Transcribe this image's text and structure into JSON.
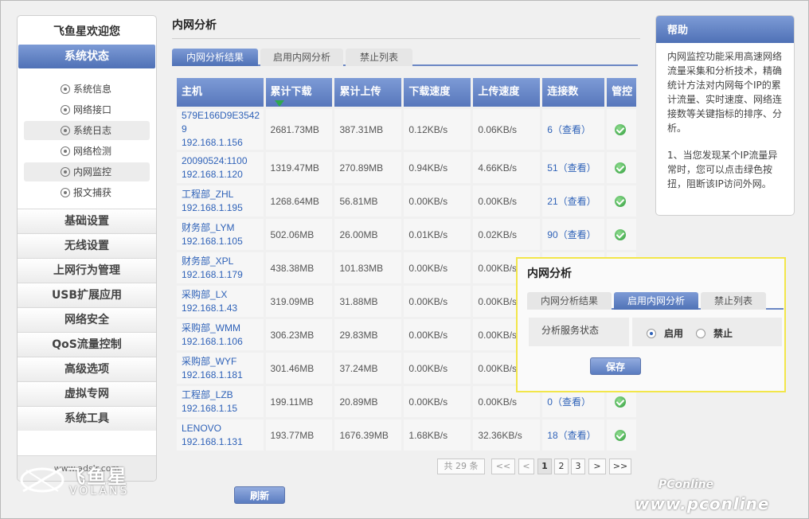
{
  "sidebar": {
    "welcome": "飞鱼星欢迎您",
    "section_head": "系统状态",
    "sub_items": [
      {
        "label": "系统信息"
      },
      {
        "label": "网络接口"
      },
      {
        "label": "系统日志"
      },
      {
        "label": "网络检测"
      },
      {
        "label": "内网监控"
      },
      {
        "label": "报文捕获"
      }
    ],
    "menu": [
      {
        "label": "基础设置"
      },
      {
        "label": "无线设置"
      },
      {
        "label": "上网行为管理"
      },
      {
        "label": "USB扩展应用"
      },
      {
        "label": "网络安全"
      },
      {
        "label": "QoS流量控制"
      },
      {
        "label": "高级选项"
      },
      {
        "label": "虚拟专网"
      },
      {
        "label": "系统工具"
      }
    ],
    "footer": "www.adslr.com"
  },
  "logo": {
    "cn": "飞鱼星",
    "en": "VOLANS"
  },
  "main": {
    "title": "内网分析",
    "tabs": [
      {
        "label": "内网分析结果"
      },
      {
        "label": "启用内网分析"
      },
      {
        "label": "禁止列表"
      }
    ],
    "columns": [
      "主机",
      "累计下载",
      "累计上传",
      "下载速度",
      "上传速度",
      "连接数",
      "管控"
    ],
    "rows": [
      {
        "host_id": "579E166D9E35429",
        "ip": "192.168.1.156",
        "down": "2681.73MB",
        "up": "387.31MB",
        "dspeed": "0.12KB/s",
        "uspeed": "0.06KB/s",
        "conn": "6（查看）"
      },
      {
        "host_id": "20090524:1100",
        "ip": "192.168.1.120",
        "down": "1319.47MB",
        "up": "270.89MB",
        "dspeed": "0.94KB/s",
        "uspeed": "4.66KB/s",
        "conn": "51（查看）"
      },
      {
        "host_id": "工程部_ZHL",
        "ip": "192.168.1.195",
        "down": "1268.64MB",
        "up": "56.81MB",
        "dspeed": "0.00KB/s",
        "uspeed": "0.00KB/s",
        "conn": "21（查看）"
      },
      {
        "host_id": "财务部_LYM",
        "ip": "192.168.1.105",
        "down": "502.06MB",
        "up": "26.00MB",
        "dspeed": "0.01KB/s",
        "uspeed": "0.02KB/s",
        "conn": "90（查看）"
      },
      {
        "host_id": "财务部_XPL",
        "ip": "192.168.1.179",
        "down": "438.38MB",
        "up": "101.83MB",
        "dspeed": "0.00KB/s",
        "uspeed": "0.00KB/s",
        "conn": ""
      },
      {
        "host_id": "采购部_LX",
        "ip": "192.168.1.43",
        "down": "319.09MB",
        "up": "31.88MB",
        "dspeed": "0.00KB/s",
        "uspeed": "0.00KB/s",
        "conn": ""
      },
      {
        "host_id": "采购部_WMM",
        "ip": "192.168.1.106",
        "down": "306.23MB",
        "up": "29.83MB",
        "dspeed": "0.00KB/s",
        "uspeed": "0.00KB/s",
        "conn": ""
      },
      {
        "host_id": "采购部_WYF",
        "ip": "192.168.1.181",
        "down": "301.46MB",
        "up": "37.24MB",
        "dspeed": "0.00KB/s",
        "uspeed": "0.00KB/s",
        "conn": ""
      },
      {
        "host_id": "工程部_LZB",
        "ip": "192.168.1.15",
        "down": "199.11MB",
        "up": "20.89MB",
        "dspeed": "0.00KB/s",
        "uspeed": "0.00KB/s",
        "conn": "0（查看）"
      },
      {
        "host_id": "LENOVO",
        "ip": "192.168.1.131",
        "down": "193.77MB",
        "up": "1676.39MB",
        "dspeed": "1.68KB/s",
        "uspeed": "32.36KB/s",
        "conn": "18（查看）"
      }
    ],
    "pager": {
      "total": "共 29 条",
      "first": "<<",
      "prev": "<",
      "pages": [
        "1",
        "2",
        "3"
      ],
      "next": ">",
      "last": ">>"
    },
    "refresh": "刷新"
  },
  "help": {
    "title": "帮助",
    "p1": "内网监控功能采用高速网络流量采集和分析技术，精确统计方法对内网每个IP的累计流量、实时速度、网络连接数等关键指标的排序、分析。",
    "p2": "1、当您发现某个IP流量异常时，您可以点击绿色按扭，阻断该IP访问外网。"
  },
  "popup": {
    "title": "内网分析",
    "tabs": [
      {
        "label": "内网分析结果"
      },
      {
        "label": "启用内网分析"
      },
      {
        "label": "禁止列表"
      }
    ],
    "field_label": "分析服务状态",
    "opt_on": "启用",
    "opt_off": "禁止",
    "save": "保存"
  },
  "watermark": {
    "line1": "PConline",
    "line2": "www.pconline"
  },
  "colors": {
    "accent": "#5a7cc0",
    "link": "#2f62b8",
    "ok": "#2e9c3a",
    "highlight_border": "#f2e64a"
  }
}
